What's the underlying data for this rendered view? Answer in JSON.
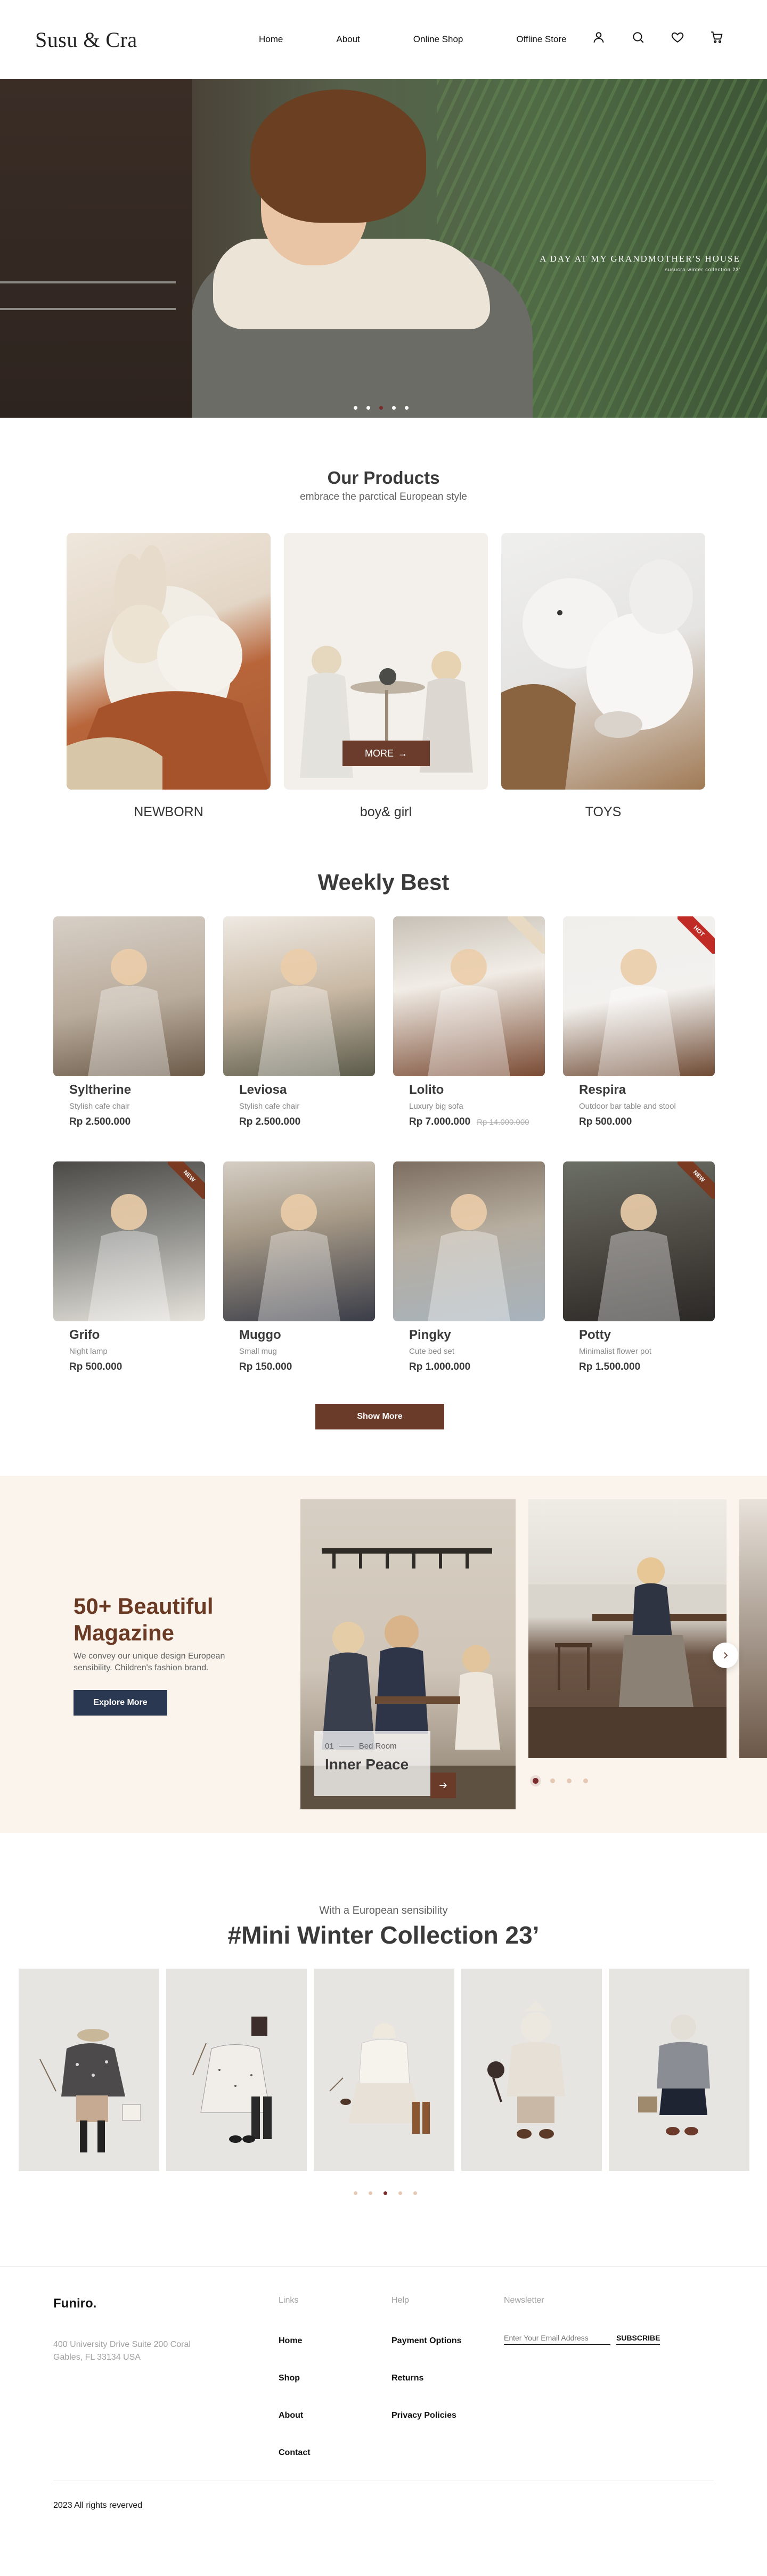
{
  "brand": {
    "logo": "Susu & Cra"
  },
  "nav": {
    "links": [
      "Home",
      "About",
      "Online Shop",
      "Offline Store"
    ],
    "icons": [
      "user-icon",
      "search-icon",
      "heart-icon",
      "cart-icon"
    ]
  },
  "hero": {
    "caption_title": "A DAY AT MY GRANDMOTHER'S HOUSE",
    "caption_sub": "susucra winter collection 23'",
    "slide_count": 5,
    "active_slide": 3
  },
  "products": {
    "title": "Our Products",
    "subtitle": "embrace the parctical European style",
    "more_label": "MORE",
    "items": [
      "NEWBORN",
      "boy& girl",
      "TOYS"
    ]
  },
  "weekly": {
    "title": "Weekly Best",
    "items": [
      {
        "name": "Syltherine",
        "desc": "Stylish cafe chair",
        "price": "Rp 2.500.000",
        "old": "",
        "badge": ""
      },
      {
        "name": "Leviosa",
        "desc": "Stylish cafe chair",
        "price": "Rp 2.500.000",
        "old": "",
        "badge": ""
      },
      {
        "name": "Lolito",
        "desc": "Luxury big sofa",
        "price": "Rp 7.000.000",
        "old": "Rp 14.000.000",
        "badge": "sale"
      },
      {
        "name": "Respira",
        "desc": "Outdoor bar table and stool",
        "price": "Rp 500.000",
        "old": "",
        "badge": "HOT"
      },
      {
        "name": "Grifo",
        "desc": "Night lamp",
        "price": "Rp 500.000",
        "old": "",
        "badge": "NEW"
      },
      {
        "name": "Muggo",
        "desc": "Small mug",
        "price": "Rp 150.000",
        "old": "",
        "badge": ""
      },
      {
        "name": "Pingky",
        "desc": "Cute bed set",
        "price": "Rp 1.000.000",
        "old": "",
        "badge": ""
      },
      {
        "name": "Potty",
        "desc": "Minimalist flower pot",
        "price": "Rp 1.500.000",
        "old": "",
        "badge": "NEW"
      }
    ],
    "show_more": "Show More"
  },
  "magazine": {
    "title": "50+ Beautiful Magazine",
    "desc": "We convey our unique design European sensibility. Children's fashion brand.",
    "button": "Explore More",
    "card_index": "01",
    "card_category": "Bed Room",
    "card_title": "Inner Peace",
    "dot_count": 4,
    "active_dot": 1
  },
  "collection": {
    "kicker": "With a European sensibility",
    "title": "#Mini Winter Collection 23’",
    "dot_count": 5,
    "active_dot": 3
  },
  "footer": {
    "logo": "Funiro.",
    "address": "400 University Drive Suite 200 Coral Gables, FL 33134 USA",
    "links_head": "Links",
    "links": [
      "Home",
      "Shop",
      "About",
      "Contact"
    ],
    "help_head": "Help",
    "help": [
      "Payment Options",
      "Returns",
      "Privacy Policies"
    ],
    "newsletter_head": "Newsletter",
    "newsletter_placeholder": "Enter Your Email Address",
    "subscribe": "SUBSCRIBE",
    "copyright": "2023 All rights reverved"
  },
  "colors": {
    "brown": "#6b3b2a",
    "navy": "#2b3852",
    "accent_dot": "#7a2b2b",
    "cream": "#faf4ec"
  }
}
